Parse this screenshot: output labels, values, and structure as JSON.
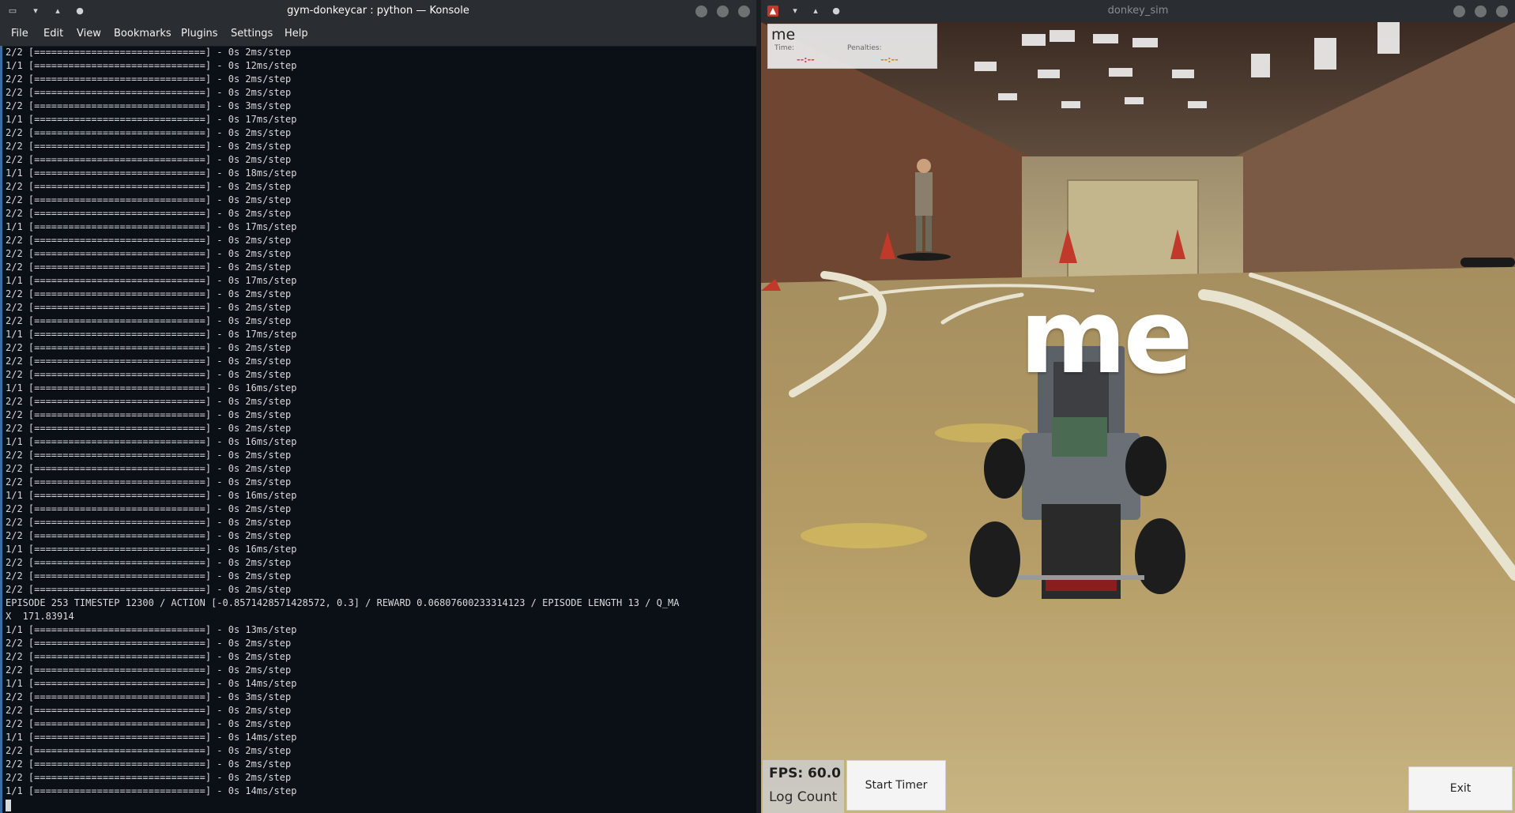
{
  "konsole": {
    "title": "gym-donkeycar : python — Konsole",
    "menu": [
      "File",
      "Edit",
      "View",
      "Bookmarks",
      "Plugins",
      "Settings",
      "Help"
    ],
    "lines": [
      "2/2 [==============================] - 0s 2ms/step",
      "1/1 [==============================] - 0s 12ms/step",
      "2/2 [==============================] - 0s 2ms/step",
      "2/2 [==============================] - 0s 2ms/step",
      "2/2 [==============================] - 0s 3ms/step",
      "1/1 [==============================] - 0s 17ms/step",
      "2/2 [==============================] - 0s 2ms/step",
      "2/2 [==============================] - 0s 2ms/step",
      "2/2 [==============================] - 0s 2ms/step",
      "1/1 [==============================] - 0s 18ms/step",
      "2/2 [==============================] - 0s 2ms/step",
      "2/2 [==============================] - 0s 2ms/step",
      "2/2 [==============================] - 0s 2ms/step",
      "1/1 [==============================] - 0s 17ms/step",
      "2/2 [==============================] - 0s 2ms/step",
      "2/2 [==============================] - 0s 2ms/step",
      "2/2 [==============================] - 0s 2ms/step",
      "1/1 [==============================] - 0s 17ms/step",
      "2/2 [==============================] - 0s 2ms/step",
      "2/2 [==============================] - 0s 2ms/step",
      "2/2 [==============================] - 0s 2ms/step",
      "1/1 [==============================] - 0s 17ms/step",
      "2/2 [==============================] - 0s 2ms/step",
      "2/2 [==============================] - 0s 2ms/step",
      "2/2 [==============================] - 0s 2ms/step",
      "1/1 [==============================] - 0s 16ms/step",
      "2/2 [==============================] - 0s 2ms/step",
      "2/2 [==============================] - 0s 2ms/step",
      "2/2 [==============================] - 0s 2ms/step",
      "1/1 [==============================] - 0s 16ms/step",
      "2/2 [==============================] - 0s 2ms/step",
      "2/2 [==============================] - 0s 2ms/step",
      "2/2 [==============================] - 0s 2ms/step",
      "1/1 [==============================] - 0s 16ms/step",
      "2/2 [==============================] - 0s 2ms/step",
      "2/2 [==============================] - 0s 2ms/step",
      "2/2 [==============================] - 0s 2ms/step",
      "1/1 [==============================] - 0s 16ms/step",
      "2/2 [==============================] - 0s 2ms/step",
      "2/2 [==============================] - 0s 2ms/step",
      "2/2 [==============================] - 0s 2ms/step",
      "EPISODE 253 TIMESTEP 12300 / ACTION [-0.8571428571428572, 0.3] / REWARD 0.06807600233314123 / EPISODE LENGTH 13 / Q_MA",
      "X  171.83914",
      "1/1 [==============================] - 0s 13ms/step",
      "2/2 [==============================] - 0s 2ms/step",
      "2/2 [==============================] - 0s 2ms/step",
      "2/2 [==============================] - 0s 2ms/step",
      "1/1 [==============================] - 0s 14ms/step",
      "2/2 [==============================] - 0s 3ms/step",
      "2/2 [==============================] - 0s 2ms/step",
      "2/2 [==============================] - 0s 2ms/step",
      "1/1 [==============================] - 0s 14ms/step",
      "2/2 [==============================] - 0s 2ms/step",
      "2/2 [==============================] - 0s 2ms/step",
      "2/2 [==============================] - 0s 2ms/step",
      "1/1 [==============================] - 0s 14ms/step"
    ]
  },
  "sim": {
    "title": "donkey_sim",
    "hud": {
      "name": "me",
      "time_label": "Time:",
      "time_value": "--:--",
      "penalties_label": "Penalties:",
      "penalties_value": "--:--"
    },
    "car_label": "me",
    "fps": "FPS: 60.0",
    "log_count": "Log Count",
    "start_timer": "Start Timer",
    "exit": "Exit",
    "colors": {
      "time_value": "#d9442a",
      "penalties_value": "#e07a1f"
    }
  }
}
